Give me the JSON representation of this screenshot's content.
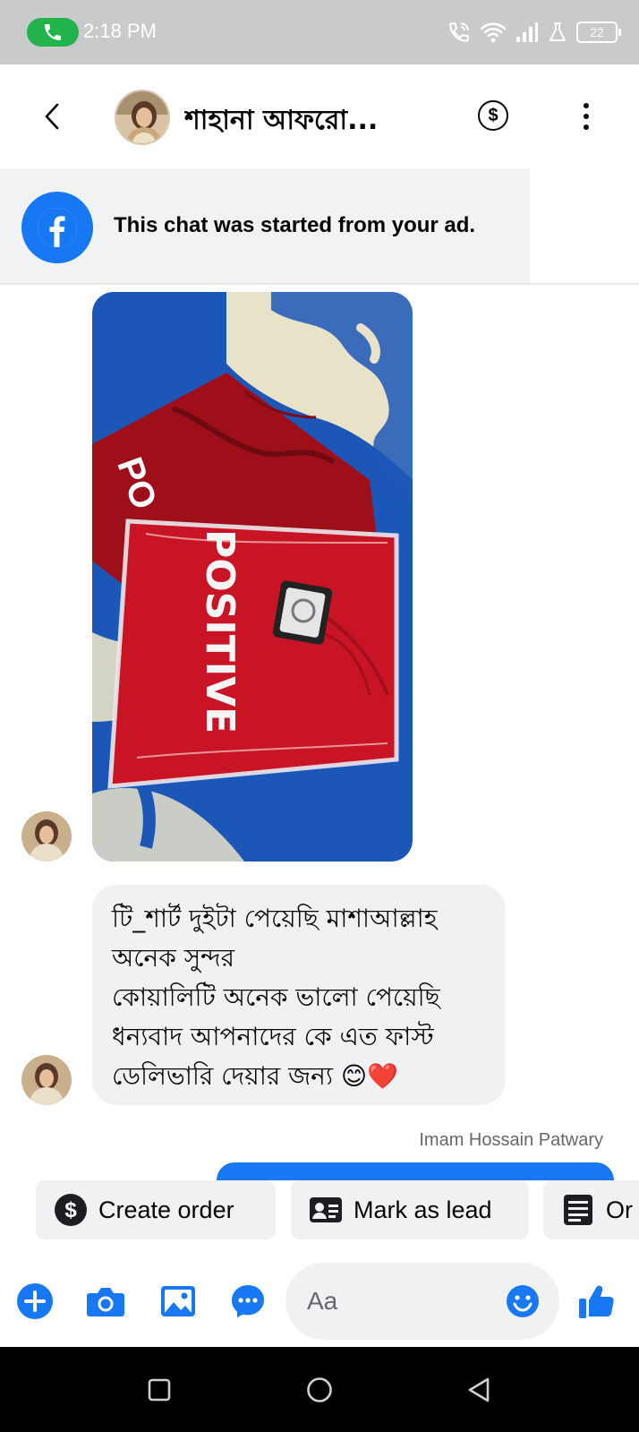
{
  "status_bar": {
    "time": "2:18 PM",
    "battery": "22",
    "icons": [
      "phone-call-icon",
      "wifi-call-icon",
      "wifi-icon",
      "signal-icon",
      "lab-icon",
      "battery-icon"
    ]
  },
  "header": {
    "contact_name": "শাহানা আফরো...",
    "back_icon": "chevron-left-icon",
    "payment_icon": "dollar-circle-icon",
    "more_icon": "more-vertical-icon"
  },
  "ad_banner": {
    "text": "This chat was started from your ad.",
    "icon": "facebook-icon"
  },
  "photo_message": {
    "print_text": "POSITIVE",
    "colors": {
      "shirt": "#b5121e",
      "fabric": "#1c57b8",
      "cream": "#e8e2c8"
    }
  },
  "text_message": {
    "lines": [
      "টি_শার্ট দুইটা পেয়েছি মাশাআল্লাহ",
      "অনেক সুন্দর",
      "কোয়ালিটি অনেক ভালো পেয়েছি",
      "ধন্যবাদ আপনাদের কে এত ফাস্ট",
      "ডেলিভারি দেয়ার জন্য 😊❤️"
    ]
  },
  "reply": {
    "sender": "Imam Hossain Patwary"
  },
  "quick_actions": [
    {
      "label": "Create order",
      "icon": "dollar-circle-icon"
    },
    {
      "label": "Mark as lead",
      "icon": "contact-card-icon"
    },
    {
      "label": "Or",
      "icon": "list-icon"
    }
  ],
  "composer": {
    "placeholder": "Aa",
    "icons": [
      "plus-icon",
      "camera-icon",
      "image-icon",
      "chat-bubble-icon",
      "emoji-icon",
      "thumbs-up-icon"
    ],
    "accent": "#1877f2"
  },
  "nav_bar": {
    "icons": [
      "recents-icon",
      "home-icon",
      "back-icon"
    ]
  }
}
